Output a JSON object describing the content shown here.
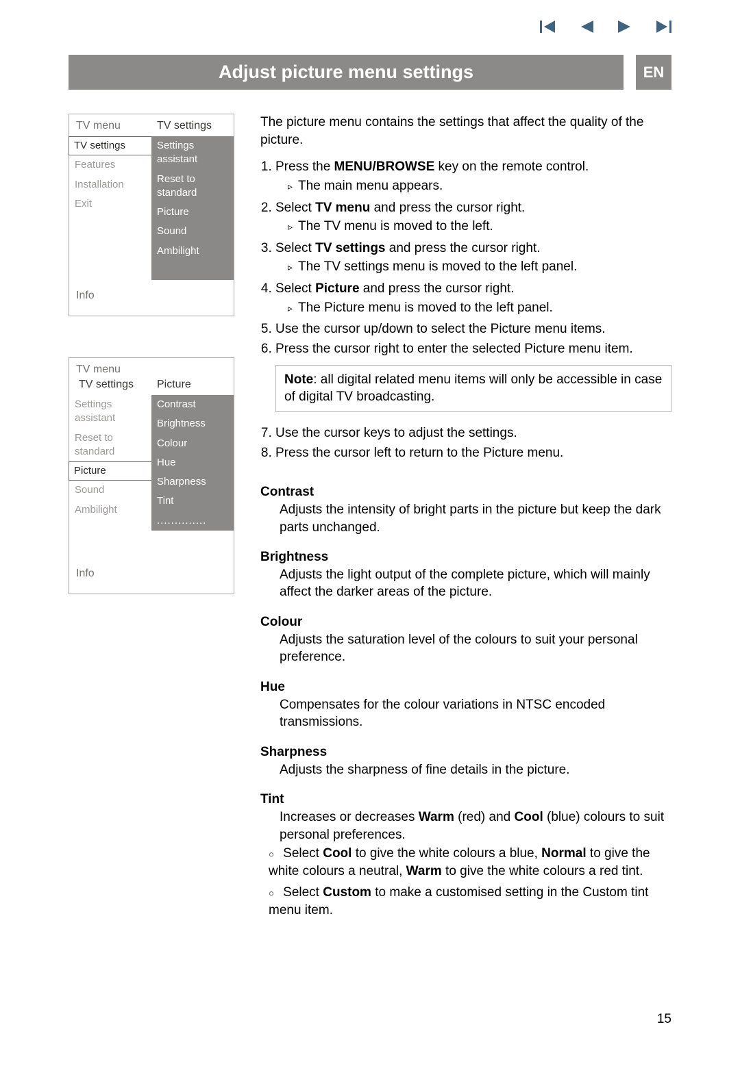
{
  "nav": {
    "first_icon": "skip-back",
    "prev_icon": "play-left",
    "next_icon": "play-right",
    "last_icon": "skip-forward"
  },
  "header": {
    "title": "Adjust picture menu settings",
    "lang": "EN"
  },
  "diagram1": {
    "left_header": "TV menu",
    "right_header": "TV settings",
    "left_items": [
      "TV settings",
      "Features",
      "Installation",
      "Exit"
    ],
    "right_items": [
      "Settings assistant",
      "Reset to standard",
      "Picture",
      "Sound",
      "Ambilight"
    ],
    "info": "Info"
  },
  "diagram2": {
    "left_header": "TV menu",
    "subheader": "TV settings",
    "right_header": "Picture",
    "left_items": [
      "Settings assistant",
      "Reset to standard",
      "Picture",
      "Sound",
      "Ambilight"
    ],
    "right_items": [
      "Contrast",
      "Brightness",
      "Colour",
      "Hue",
      "Sharpness",
      "Tint",
      ".............."
    ],
    "info": "Info"
  },
  "intro": "The picture menu contains the settings that affect the quality of the picture.",
  "steps": {
    "s1": "Press the ",
    "s1_bold": "MENU/BROWSE",
    "s1_tail": " key on the remote control.",
    "s1_sub": "The main menu appears.",
    "s2_a": "Select ",
    "s2_bold": "TV menu",
    "s2_b": " and press the cursor right.",
    "s2_sub": "The TV menu is moved to the left.",
    "s3_a": "Select ",
    "s3_bold": "TV settings",
    "s3_b": " and press the cursor right.",
    "s3_sub": "The TV settings menu is moved to the left panel.",
    "s4_a": "Select ",
    "s4_bold": "Picture",
    "s4_b": " and press the cursor right.",
    "s4_sub": "The Picture menu is moved to the left panel.",
    "s5": "Use the cursor up/down to select the Picture menu items.",
    "s6": "Press the cursor right to enter the selected Picture menu item."
  },
  "note_bold": "Note",
  "note_text": ": all digital related menu items will only be accessible in case of digital TV broadcasting.",
  "steps2": {
    "s7": "Use the cursor keys to adjust the settings.",
    "s8": "Press the cursor left to return to the Picture menu."
  },
  "defs": {
    "contrast_hd": "Contrast",
    "contrast_body": "Adjusts the intensity of bright parts in the picture but keep the dark parts unchanged.",
    "brightness_hd": "Brightness",
    "brightness_body": "Adjusts the light output of the complete picture, which will mainly affect the darker areas of the picture.",
    "colour_hd": "Colour",
    "colour_body": "Adjusts the saturation level of the colours to suit your personal preference.",
    "hue_hd": "Hue",
    "hue_body": "Compensates for the colour variations in NTSC encoded transmissions.",
    "sharpness_hd": "Sharpness",
    "sharpness_body": "Adjusts the sharpness of fine details in the picture.",
    "tint_hd": "Tint",
    "tint_body_a": "Increases or decreases ",
    "tint_body_warm": "Warm",
    "tint_body_b": " (red) and ",
    "tint_body_cool": "Cool",
    "tint_body_c": " (blue) colours to suit personal preferences.",
    "tint_bullet1_a": "Select ",
    "tint_bullet1_cool": "Cool",
    "tint_bullet1_b": " to give the white colours a blue, ",
    "tint_bullet1_normal": "Normal",
    "tint_bullet1_c": " to give the white colours a neutral, ",
    "tint_bullet1_warm": "Warm",
    "tint_bullet1_d": " to give the white colours a red tint.",
    "tint_bullet2_a": "Select ",
    "tint_bullet2_custom": "Custom",
    "tint_bullet2_b": " to make a customised setting in the Custom tint menu item."
  },
  "page_number": "15"
}
